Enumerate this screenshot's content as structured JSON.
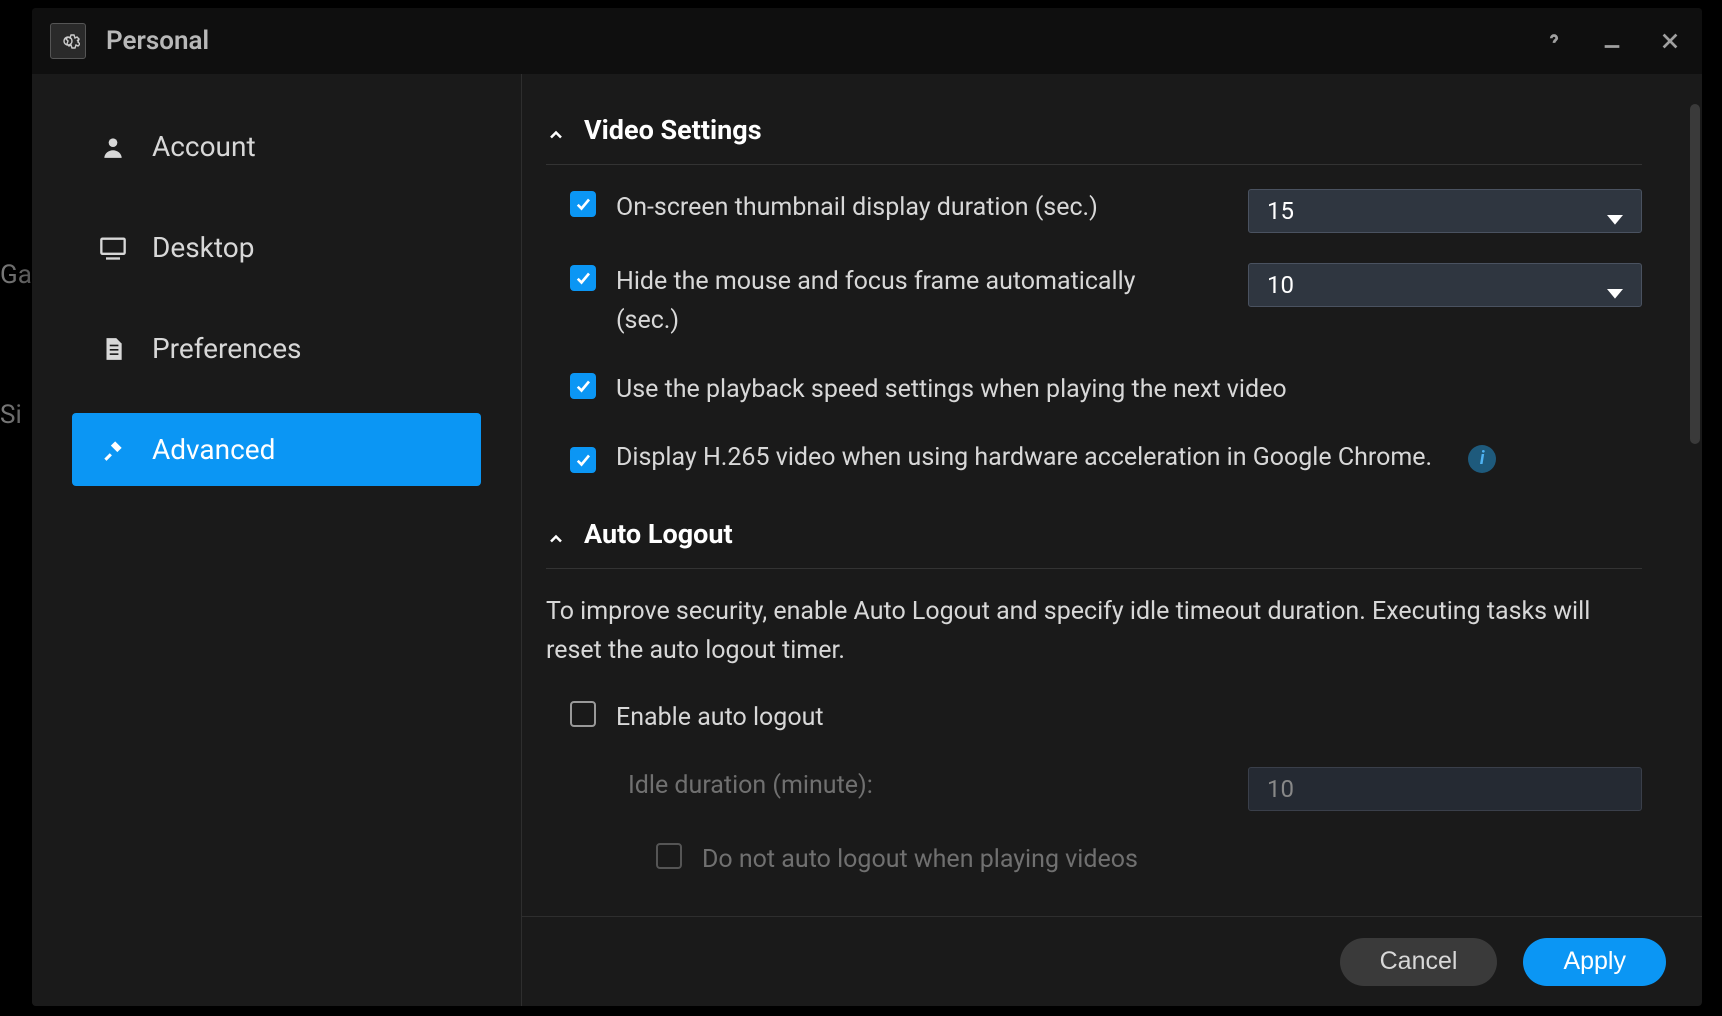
{
  "window": {
    "title": "Personal"
  },
  "sidebar": {
    "items": [
      {
        "label": "Account"
      },
      {
        "label": "Desktop"
      },
      {
        "label": "Preferences"
      },
      {
        "label": "Advanced"
      }
    ]
  },
  "sections": {
    "video": {
      "title": "Video Settings",
      "thumbnail_label": "On-screen thumbnail display duration (sec.)",
      "thumbnail_value": "15",
      "hide_mouse_label": "Hide the mouse and focus frame automatically (sec.)",
      "hide_mouse_value": "10",
      "playback_speed_label": "Use the playback speed settings when playing the next video",
      "h265_label": "Display H.265 video when using hardware acceleration in Google Chrome."
    },
    "auto_logout": {
      "title": "Auto Logout",
      "description": "To improve security, enable Auto Logout and specify idle timeout duration. Executing tasks will reset the auto logout timer.",
      "enable_label": "Enable auto logout",
      "idle_label": "Idle duration (minute):",
      "idle_value": "10",
      "no_logout_playing_label": "Do not auto logout when playing videos"
    }
  },
  "footer": {
    "cancel": "Cancel",
    "apply": "Apply"
  }
}
